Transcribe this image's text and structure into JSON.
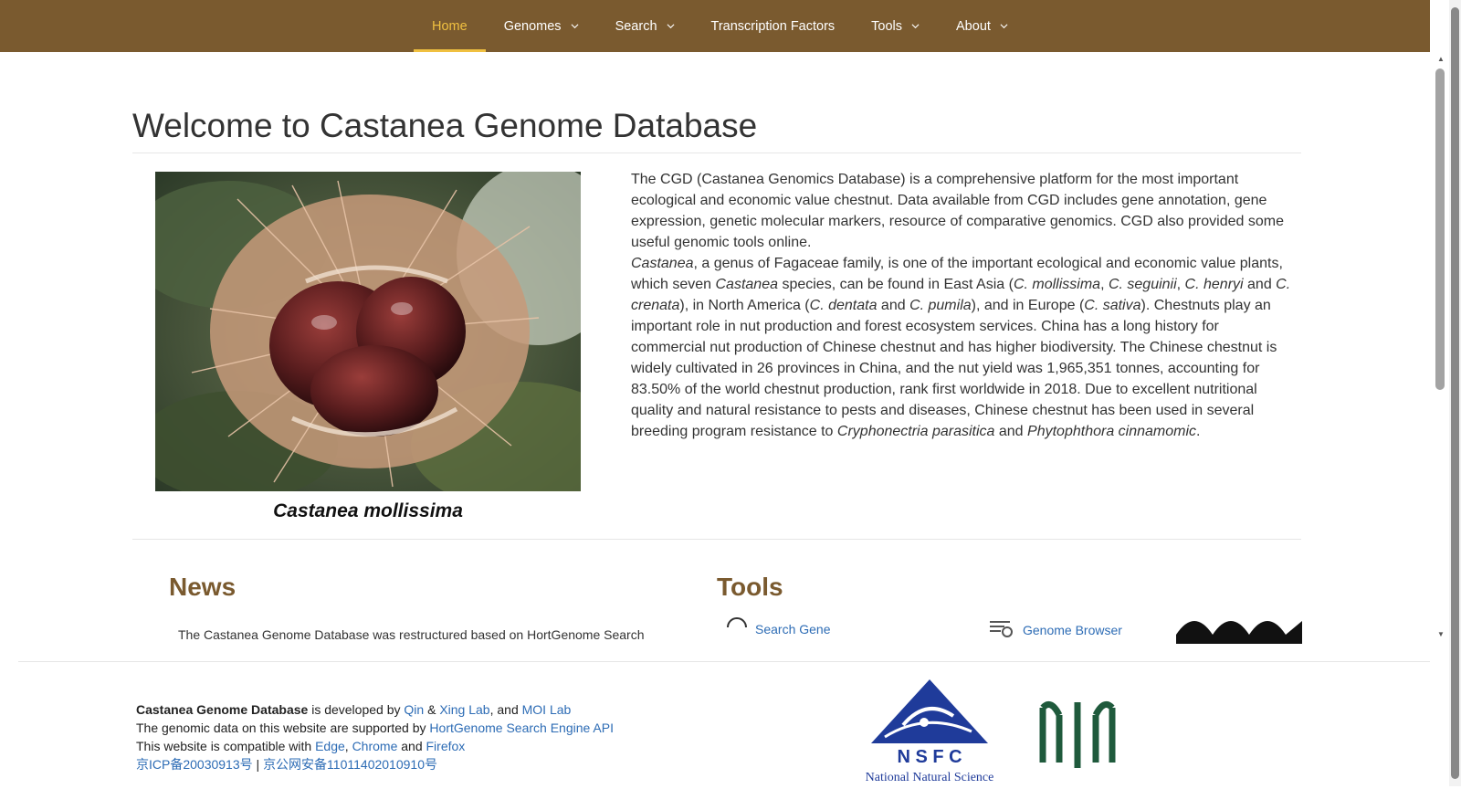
{
  "nav": {
    "items": [
      {
        "label": "Home",
        "dropdown": false,
        "active": true
      },
      {
        "label": "Genomes",
        "dropdown": true,
        "active": false
      },
      {
        "label": "Search",
        "dropdown": true,
        "active": false
      },
      {
        "label": "Transcription Factors",
        "dropdown": false,
        "active": false
      },
      {
        "label": "Tools",
        "dropdown": true,
        "active": false
      },
      {
        "label": "About",
        "dropdown": true,
        "active": false
      }
    ]
  },
  "page": {
    "title": "Welcome to Castanea Genome Database",
    "photo_caption": "Castanea mollissima"
  },
  "intro": {
    "p1": "The CGD (Castanea Genomics Database) is a comprehensive platform for the most important ecological and economic value chestnut. Data available from CGD includes gene annotation, gene expression, genetic molecular markers, resource of comparative genomics. CGD also provided some useful genomic tools online.",
    "p2": {
      "castanea": "Castanea",
      "t1": ", a genus of Fagaceae family, is one of the important ecological and economic value plants, which seven ",
      "castanea2": "Castanea",
      "t2": " species, can be found in East Asia (",
      "mollissima": "C. mollissima",
      "t3": ", ",
      "seguinii": "C. seguinii",
      "t4": ", ",
      "henryi": "C. henryi",
      "t5": " and ",
      "crenata": "C. crenata",
      "t6": "), in North America (",
      "dentata": "C. dentata",
      "t7": " and ",
      "pumila": "C. pumila",
      "t8": "), and in Europe (",
      "sativa": "C. sativa",
      "t9": "). Chestnuts play an important role in nut production and forest ecosystem services. China has a long history for commercial nut production of Chinese chestnut and has higher biodiversity. The Chinese chestnut is widely cultivated in 26 provinces in China, and the nut yield was 1,965,351 tonnes, accounting for 83.50% of the world chestnut production, rank first worldwide in 2018. Due to excellent nutritional quality and natural resistance to pests and diseases, Chinese chestnut has been used in several breeding program resistance to ",
      "cryph": "Cryphonectria parasitica",
      "t10": " and ",
      "phyto": "Phytophthora cinnamomic",
      "t11": "."
    }
  },
  "news": {
    "heading": "News",
    "first_item": "The Castanea Genome Database was restructured based on HortGenome Search"
  },
  "tools": {
    "heading": "Tools",
    "links": [
      "Search Gene",
      "Genome Browser"
    ]
  },
  "footer": {
    "db_name": "Castanea Genome Database",
    "dev_prefix": " is developed by ",
    "qin": "Qin",
    "amp": " & ",
    "xing": "Xing Lab",
    "and1": ", and ",
    "moi": "MOI Lab",
    "line2_prefix": "The genomic data on this website are supported by ",
    "hortgenome": "HortGenome Search Engine API",
    "line3_prefix": "This website is compatible with ",
    "edge": "Edge",
    "comma": ", ",
    "chrome": "Chrome",
    "and2": " and ",
    "firefox": "Firefox",
    "icp": "京ICP备20030913号",
    "sep": " | ",
    "police": "京公网安备11011402010910号",
    "nsfc_letters": "N S F C",
    "nsfc_caption": "National Natural Science"
  },
  "colors": {
    "navbar": "#7a5a2f",
    "active": "#f0c040",
    "link": "#2d6cb5",
    "heading": "#7a5a2f"
  }
}
